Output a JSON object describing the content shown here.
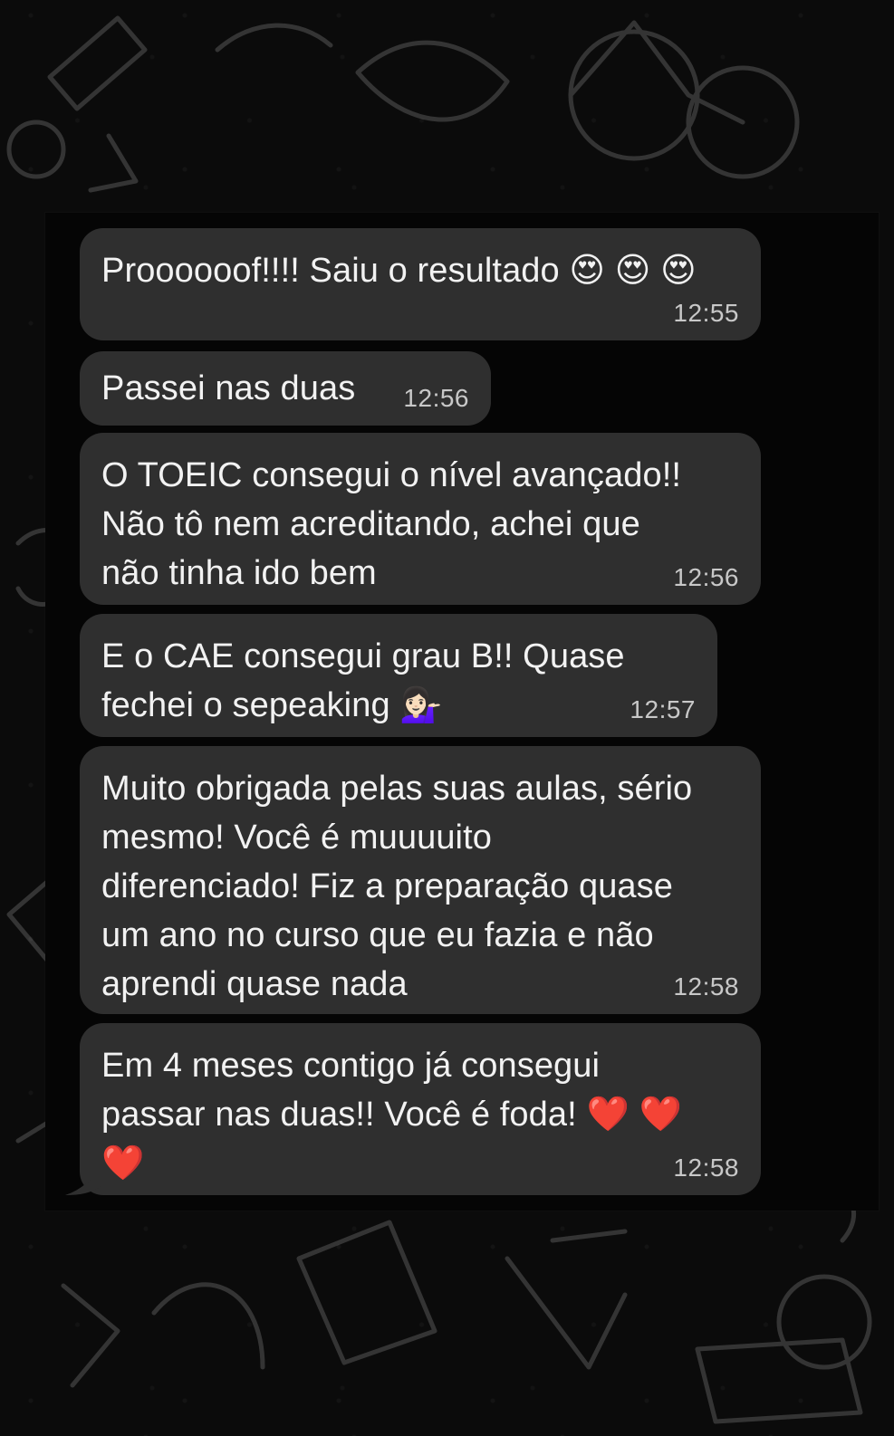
{
  "messages": [
    {
      "text": "Proooooof!!!! Saiu o resultado 😍 😍 😍",
      "time": "12:55"
    },
    {
      "text": "Passei nas duas",
      "time": "12:56"
    },
    {
      "text": "O TOEIC consegui o nível avançado!!\nNão tô nem acreditando, achei que\nnão tinha ido bem",
      "time": "12:56"
    },
    {
      "text": "E o CAE consegui grau B!! Quase\nfechei o sepeaking 💁🏻‍♀️",
      "time": "12:57"
    },
    {
      "text": "Muito obrigada pelas suas aulas, sério\nmesmo! Você é muuuuito\ndiferenciado! Fiz a preparação quase\num ano no curso que eu fazia e não\naprendi quase nada",
      "time": "12:58"
    },
    {
      "text": "Em 4 meses contigo já consegui\npassar nas duas!! Você é foda! ❤️ ❤️\n❤️",
      "time": "12:58"
    }
  ],
  "colors": {
    "background": "#0b0b0b",
    "bubble": "#2f2f2f",
    "text": "#f2f2f2",
    "time": "#c8c8c8"
  }
}
